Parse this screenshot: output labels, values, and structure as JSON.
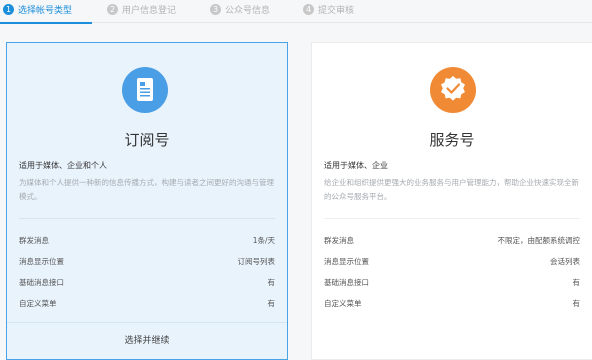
{
  "steps": [
    {
      "num": "1",
      "label": "选择帐号类型",
      "active": true
    },
    {
      "num": "2",
      "label": "用户信息登记",
      "active": false
    },
    {
      "num": "3",
      "label": "公众号信息",
      "active": false
    },
    {
      "num": "4",
      "label": "提交审核",
      "active": false
    }
  ],
  "colors": {
    "accent": "#1c8fdb",
    "subscription_icon": "#4a9ee6",
    "service_icon": "#f08a35",
    "selected_bg": "#e9f3fc"
  },
  "subscription": {
    "icon": "document-icon",
    "title": "订阅号",
    "subtitle": "适用于媒体、企业和个人",
    "description": "为媒体和个人提供一种新的信息传播方式，构建与读者之间更好的沟通与管理模式。",
    "features": [
      {
        "key": "群发消息",
        "value": "1条/天"
      },
      {
        "key": "消息显示位置",
        "value": "订阅号列表"
      },
      {
        "key": "基础消息接口",
        "value": "有"
      },
      {
        "key": "自定义菜单",
        "value": "有"
      }
    ],
    "select_label": "选择并继续"
  },
  "service": {
    "icon": "verified-check-icon",
    "title": "服务号",
    "subtitle": "适用于媒体、企业",
    "description": "给企业和组织提供更强大的业务服务与用户管理能力，帮助企业快速实现全新的公众号服务平台。",
    "features": [
      {
        "key": "群发消息",
        "value": "不限定，由配额系统调控"
      },
      {
        "key": "消息显示位置",
        "value": "会话列表"
      },
      {
        "key": "基础消息接口",
        "value": "有"
      },
      {
        "key": "自定义菜单",
        "value": "有"
      }
    ]
  }
}
